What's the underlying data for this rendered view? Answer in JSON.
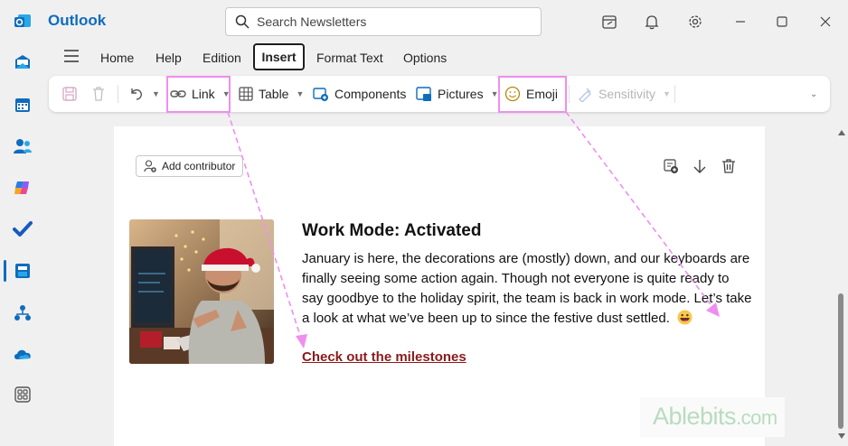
{
  "app": {
    "title": "Outlook"
  },
  "search": {
    "placeholder": "Search Newsletters"
  },
  "menu": {
    "tabs": [
      {
        "label": "Home"
      },
      {
        "label": "Help"
      },
      {
        "label": "Edition"
      },
      {
        "label": "Insert"
      },
      {
        "label": "Format Text"
      },
      {
        "label": "Options"
      }
    ]
  },
  "ribbon": {
    "link": "Link",
    "table": "Table",
    "components": "Components",
    "pictures": "Pictures",
    "emoji": "Emoji",
    "sensitivity": "Sensitivity"
  },
  "editor": {
    "add_contributor": "Add contributor",
    "headline": "Work Mode: Activated",
    "paragraph": "January is here, the decorations are (mostly) down, and our keyboards are finally seeing some action again. Though not everyone is quite ready to say goodbye to the holiday spirit, the team is back in work mode. Let’s take a look at what we’ve been up to since the festive dust settled.",
    "link_text": "Check out the milestones"
  },
  "watermark": {
    "brand": "Ablebits",
    "tld": ".com"
  },
  "colors": {
    "accent": "#0f6cbd",
    "highlight": "#f08ef0",
    "link": "#8b1a1a"
  }
}
